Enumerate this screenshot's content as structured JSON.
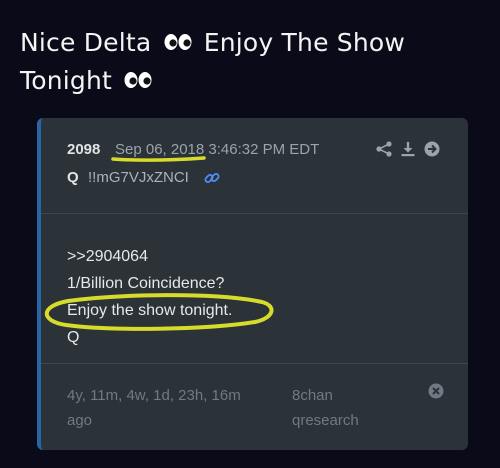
{
  "headline": {
    "line1_a": "Nice Delta",
    "line1_b": "Enjoy The Show",
    "line2": "Tonight",
    "eyes_icon": "eyes-emoji"
  },
  "post": {
    "number": "2098",
    "date": "Sep 06, 2018 3:46:32 PM EDT",
    "author": "Q",
    "tripcode": "!!mG7VJxZNCI",
    "tools": [
      "share-icon",
      "download-icon",
      "arrow-right-circle-icon"
    ],
    "body": [
      ">>2904064",
      "1/Billion Coincidence?",
      "Enjoy the show tonight.",
      "Q"
    ],
    "footer": {
      "time_line1": "4y, 11m, 4w, 1d, 23h, 16m",
      "time_line2": "ago",
      "source_line1": "8chan",
      "source_line2": "qresearch",
      "close_icon": "close-circle-icon"
    }
  },
  "colors": {
    "background": "#0b0a18",
    "card": "#2b3238",
    "accent_border": "#2a65a6",
    "highlight": "#d7dc2c",
    "link": "#4f8ff7"
  }
}
